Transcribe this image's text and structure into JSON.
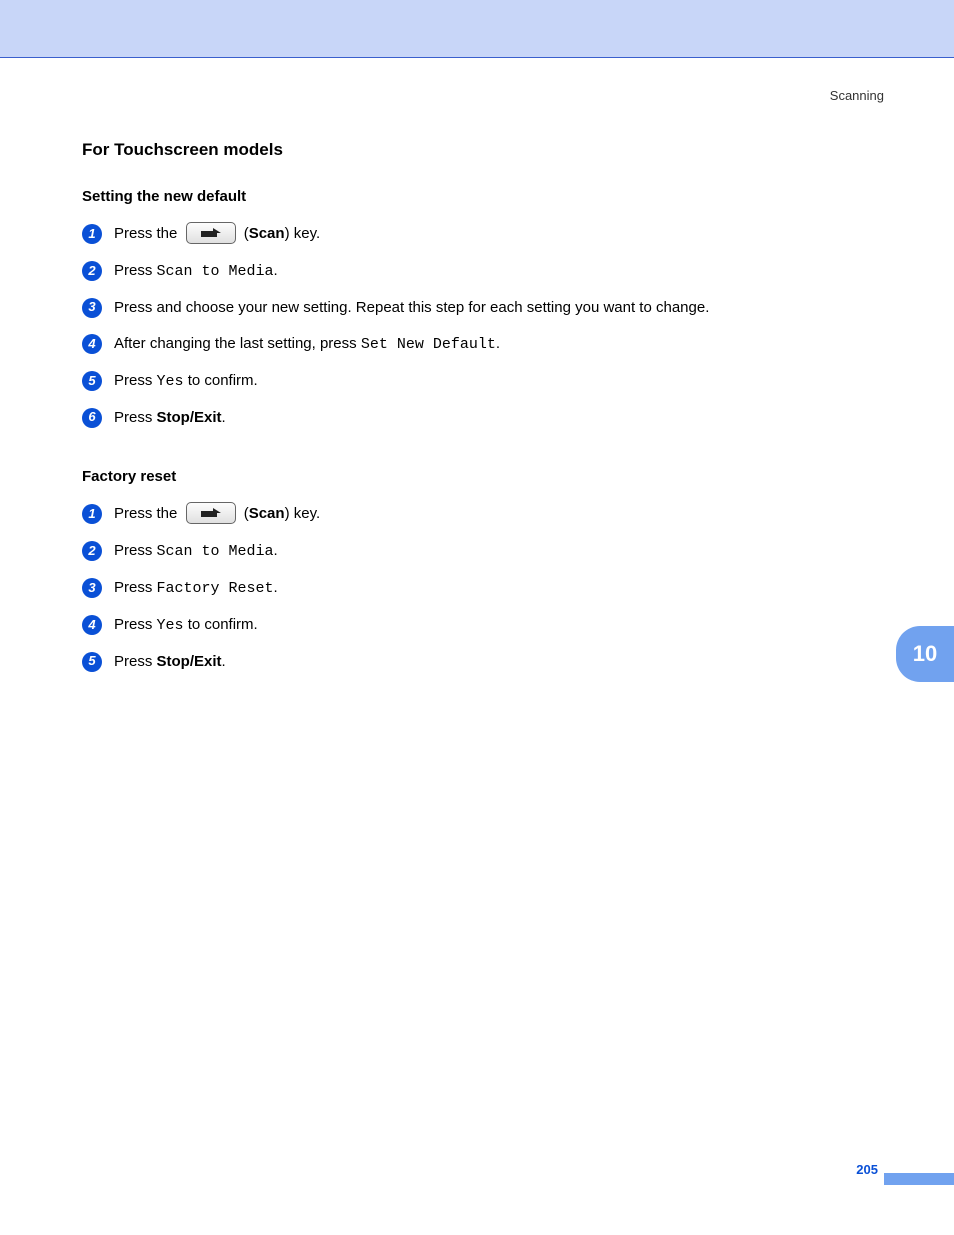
{
  "chapter_label": "Scanning",
  "chapter_tab": "10",
  "page_number": "205",
  "heading": "For Touchscreen models",
  "sections": [
    {
      "title": "Setting the new default",
      "steps": [
        {
          "n": "1",
          "pre": "Press the ",
          "has_key": true,
          "post_open": " (",
          "bold": "Scan",
          "post_close": ") key."
        },
        {
          "n": "2",
          "pre": "Press ",
          "mono": "Scan to Media",
          "post": "."
        },
        {
          "n": "3",
          "plain": "Press and choose your new setting. Repeat this step for each setting you want to change."
        },
        {
          "n": "4",
          "pre": "After changing the last setting, press ",
          "mono": "Set New Default",
          "post": "."
        },
        {
          "n": "5",
          "pre": "Press ",
          "mono": "Yes",
          "post": " to confirm."
        },
        {
          "n": "6",
          "pre": "Press ",
          "bold": "Stop/Exit",
          "post": "."
        }
      ]
    },
    {
      "title": "Factory reset",
      "steps": [
        {
          "n": "1",
          "pre": "Press the ",
          "has_key": true,
          "post_open": " (",
          "bold": "Scan",
          "post_close": ") key."
        },
        {
          "n": "2",
          "pre": "Press ",
          "mono": "Scan to Media",
          "post": "."
        },
        {
          "n": "3",
          "pre": "Press ",
          "mono": "Factory Reset",
          "post": "."
        },
        {
          "n": "4",
          "pre": "Press ",
          "mono": "Yes",
          "post": " to confirm."
        },
        {
          "n": "5",
          "pre": "Press ",
          "bold": "Stop/Exit",
          "post": "."
        }
      ]
    }
  ]
}
